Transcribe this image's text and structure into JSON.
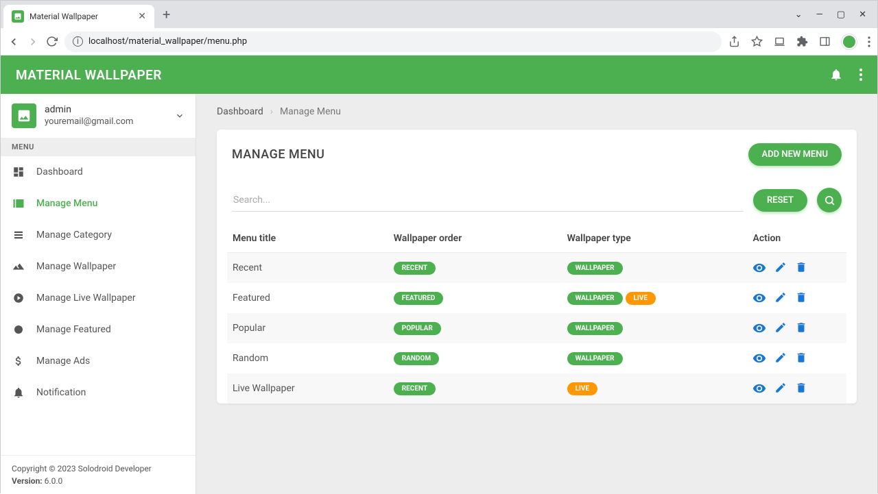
{
  "browser": {
    "tab_title": "Material Wallpaper",
    "url": "localhost/material_wallpaper/menu.php"
  },
  "header": {
    "title": "MATERIAL WALLPAPER"
  },
  "user": {
    "name": "admin",
    "email": "youremail@gmail.com"
  },
  "sidebar": {
    "section_label": "MENU",
    "items": [
      {
        "label": "Dashboard"
      },
      {
        "label": "Manage Menu"
      },
      {
        "label": "Manage Category"
      },
      {
        "label": "Manage Wallpaper"
      },
      {
        "label": "Manage Live Wallpaper"
      },
      {
        "label": "Manage Featured"
      },
      {
        "label": "Manage Ads"
      },
      {
        "label": "Notification"
      }
    ],
    "footer": {
      "copyright": "Copyright © 2023 Solodroid Developer",
      "version_label": "Version:",
      "version": "6.0.0"
    }
  },
  "breadcrumb": {
    "root": "Dashboard",
    "current": "Manage Menu"
  },
  "page": {
    "title": "MANAGE MENU",
    "add_button": "ADD NEW MENU",
    "search_placeholder": "Search...",
    "reset_button": "RESET"
  },
  "table": {
    "headers": {
      "title": "Menu title",
      "order": "Wallpaper order",
      "type": "Wallpaper type",
      "action": "Action"
    },
    "rows": [
      {
        "title": "Recent",
        "order": [
          {
            "text": "RECENT",
            "color": "green"
          }
        ],
        "type": [
          {
            "text": "WALLPAPER",
            "color": "green"
          }
        ]
      },
      {
        "title": "Featured",
        "order": [
          {
            "text": "FEATURED",
            "color": "green"
          }
        ],
        "type": [
          {
            "text": "WALLPAPER",
            "color": "green"
          },
          {
            "text": "LIVE",
            "color": "orange"
          }
        ]
      },
      {
        "title": "Popular",
        "order": [
          {
            "text": "POPULAR",
            "color": "green"
          }
        ],
        "type": [
          {
            "text": "WALLPAPER",
            "color": "green"
          }
        ]
      },
      {
        "title": "Random",
        "order": [
          {
            "text": "RANDOM",
            "color": "green"
          }
        ],
        "type": [
          {
            "text": "WALLPAPER",
            "color": "green"
          }
        ]
      },
      {
        "title": "Live Wallpaper",
        "order": [
          {
            "text": "RECENT",
            "color": "green"
          }
        ],
        "type": [
          {
            "text": "LIVE",
            "color": "orange"
          }
        ]
      }
    ]
  }
}
